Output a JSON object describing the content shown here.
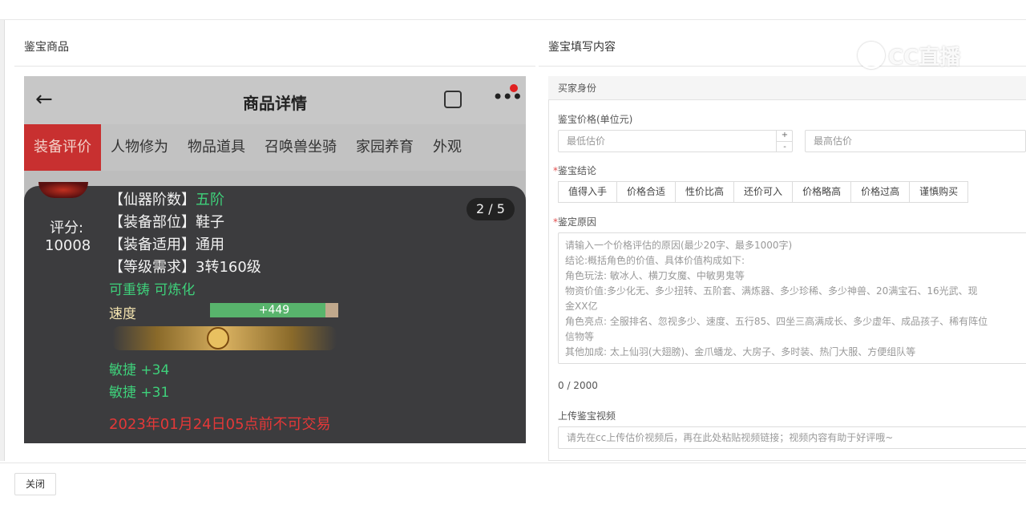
{
  "left_panel": {
    "title": "鉴宝商品",
    "phone": {
      "header_title": "商品详情",
      "back_icon": "arrow-left-icon",
      "share_icon": "share-icon",
      "more_icon": "more-icon",
      "tabs": [
        "装备评价",
        "人物修为",
        "物品道具",
        "召唤兽坐骑",
        "家园养育",
        "外观"
      ],
      "score_label": "评分:",
      "score_value": "10008",
      "pager": "2 / 5",
      "lines": [
        {
          "label": "【仙器阶数】",
          "value": "五阶"
        },
        {
          "label": "【装备部位】",
          "value": "鞋子"
        },
        {
          "label": "【装备适用】",
          "value": "通用"
        },
        {
          "label": "【等级需求】",
          "value": "3转160级"
        }
      ],
      "recast": "可重铸 可炼化",
      "speed_label": "速度",
      "speed_bar_text": "+449",
      "speed_bar_fill": 0.9,
      "agility1": "敏捷 +34",
      "agility2": "敏捷 +31",
      "trade_note": "2023年01月24日05点前不可交易"
    }
  },
  "right_panel": {
    "title": "鉴宝填写内容",
    "section_head": "买家身份",
    "price_label": "鉴宝价格(单位元)",
    "min_placeholder": "最低估价",
    "max_placeholder": "最高估价",
    "stepper_plus": "+",
    "stepper_minus": "-",
    "conclusion_label": "鉴宝结论",
    "conclusion_options": [
      "值得入手",
      "价格合适",
      "性价比高",
      "还价可入",
      "价格略高",
      "价格过高",
      "谨慎购买"
    ],
    "reason_label": "鉴定原因",
    "reason_placeholder_lines": [
      "请输入一个价格评估的原因(最少20字、最多1000字)",
      "  结论:概括角色的价值、具体价值构成如下:",
      "  角色玩法: 敏冰人、横刀女魔、中敏男鬼等",
      "  物资价值:多少化无、多少扭转、五阶套、满炼器、多少珍稀、多少神兽、20满宝石、16光武、现",
      "金XX亿",
      "  角色亮点: 全服排名、忽视多少、速度、五行85、四坐三高满成长、多少虚年、成品孩子、稀有阵位",
      "信物等",
      "  其他加成: 太上仙羽(大翅膀)、金爪蟠龙、大房子、多时装、热门大服、方便组队等"
    ],
    "counter": "0 / 2000",
    "video_label": "上传鉴宝视频",
    "video_placeholder": "请先在cc上传估价视频后，再在此处粘贴视频链接；视频内容有助于好评哦~"
  },
  "watermark": "CC直播",
  "footer": {
    "close_label": "关闭"
  },
  "required_mark": "*"
}
